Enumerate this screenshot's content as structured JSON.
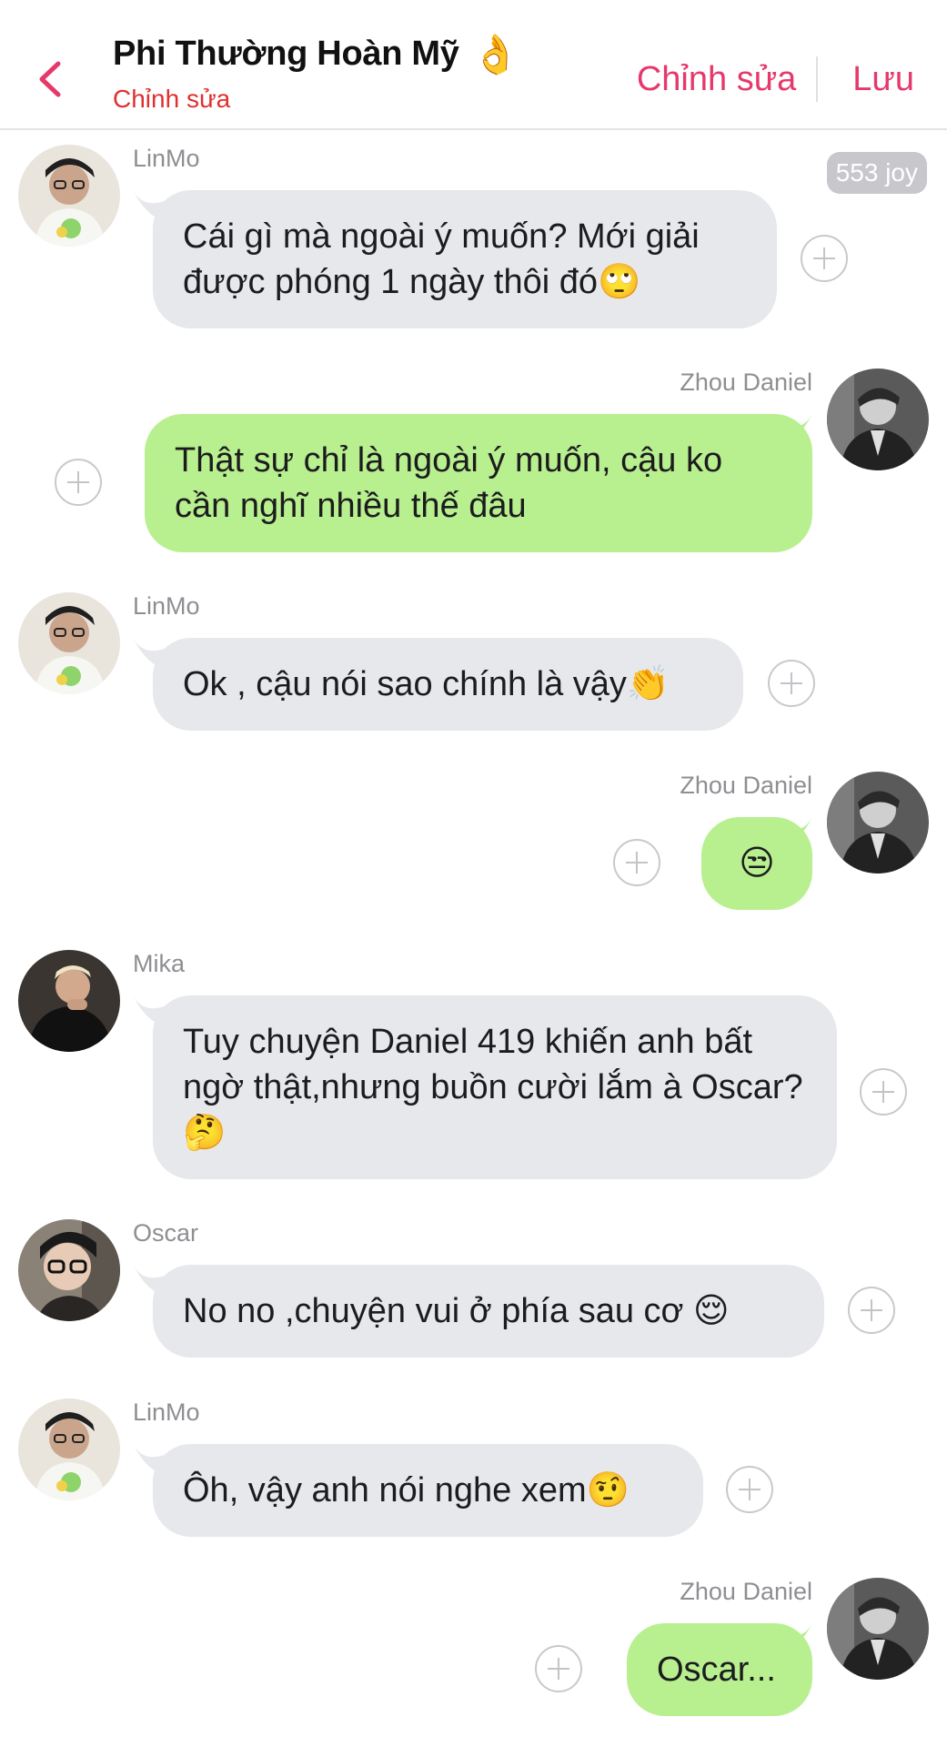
{
  "header": {
    "title": "Phi Thường Hoàn Mỹ",
    "title_emoji": "👌",
    "subtitle": "Chỉnh sửa",
    "edit_label": "Chỉnh sửa",
    "save_label": "Lưu"
  },
  "colors": {
    "accent": "#e5396c",
    "subtitle": "#e0302f",
    "incoming_bubble": "#e6e8ec",
    "outgoing_bubble": "#b8ef8f"
  },
  "badge": {
    "joy": "553 joy"
  },
  "messages": [
    {
      "sender": "LinMo",
      "text": "Cái gì mà ngoài ý muốn? Mới giải được phóng 1 ngày thôi đó🙄",
      "direction": "in"
    },
    {
      "sender": "Zhou Daniel",
      "text": "Thật sự chỉ là ngoài ý muốn, cậu ko cần nghĩ nhiều thế đâu",
      "direction": "out"
    },
    {
      "sender": "LinMo",
      "text": "Ok , cậu nói sao chính là vậy👏",
      "direction": "in"
    },
    {
      "sender": "Zhou Daniel",
      "text": "😒",
      "direction": "out"
    },
    {
      "sender": "Mika",
      "text": "Tuy chuyện Daniel 419 khiến anh bất ngờ thật,nhưng buồn cười lắm à Oscar?🤔",
      "direction": "in"
    },
    {
      "sender": "Oscar",
      "text": "No no ,chuyện vui  ở phía sau cơ 😌",
      "direction": "in"
    },
    {
      "sender": "LinMo",
      "text": "Ôh, vậy anh nói nghe xem🤨",
      "direction": "in"
    },
    {
      "sender": "Zhou Daniel",
      "text": "Oscar...",
      "direction": "out"
    }
  ]
}
